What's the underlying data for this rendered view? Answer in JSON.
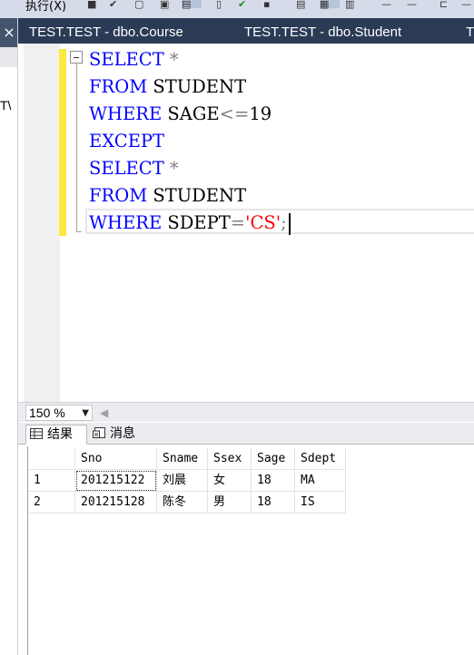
{
  "toolbar": {
    "execute_label": "执行(X)"
  },
  "left_panel": {
    "close_glyph": "×",
    "clipped_text": "T\\"
  },
  "tabs": [
    {
      "label": "TEST.TEST - dbo.Course"
    },
    {
      "label": "TEST.TEST - dbo.Student"
    },
    {
      "label": "T"
    }
  ],
  "editor": {
    "lines": [
      {
        "kw": "SELECT",
        "rest": " *"
      },
      {
        "kw": "FROM",
        "rest": " STUDENT"
      },
      {
        "kw": "WHERE",
        "rest1": " SAGE",
        "op": "<=",
        "rest2": "19"
      },
      {
        "kw": "EXCEPT"
      },
      {
        "kw": "SELECT",
        "rest": " *"
      },
      {
        "kw": "FROM",
        "rest": " STUDENT"
      },
      {
        "kw": "WHERE",
        "rest1": " SDEPT",
        "op": "=",
        "str": "'CS'",
        "end": ";"
      }
    ]
  },
  "zoom": {
    "value": "150 %"
  },
  "results_tabs": [
    {
      "label": "结果"
    },
    {
      "label": "消息"
    }
  ],
  "grid": {
    "columns": [
      "",
      "Sno",
      "Sname",
      "Ssex",
      "Sage",
      "Sdept"
    ],
    "rows": [
      [
        "1",
        "201215122",
        "刘晨",
        "女",
        "18",
        "MA"
      ],
      [
        "2",
        "201215128",
        "陈冬",
        "男",
        "18",
        "IS"
      ]
    ]
  },
  "colors": {
    "keyword": "#0000ff",
    "string": "#ff0000",
    "operator": "#808080",
    "tab_bar": "#2b3a55",
    "change_bar": "#fce93c"
  }
}
